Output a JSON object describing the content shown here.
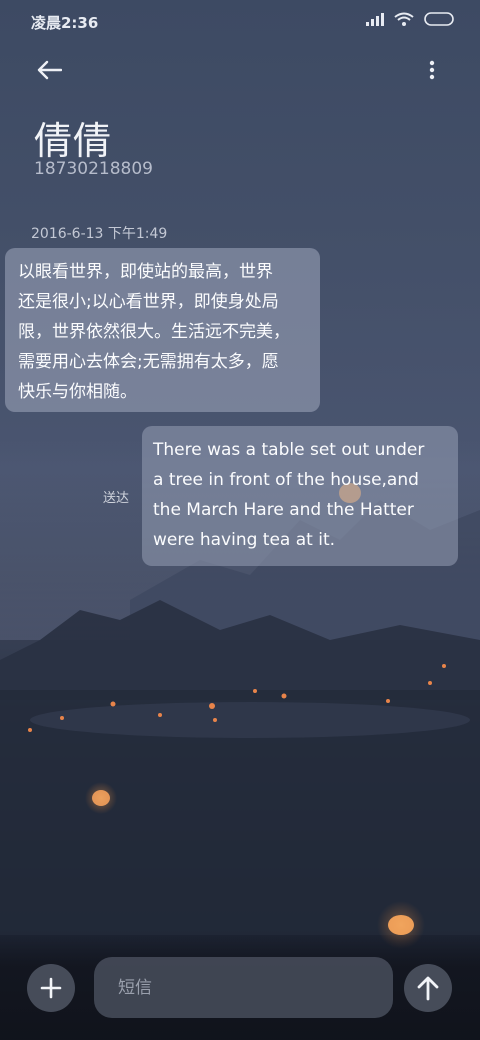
{
  "status_bar": {
    "time": "凌晨2:36",
    "icons": [
      "signal-icon",
      "wifi-icon",
      "battery-icon"
    ]
  },
  "header": {
    "back_icon": "back-arrow-icon",
    "more_icon": "more-vert-icon"
  },
  "contact": {
    "name": "倩倩",
    "number": "18730218809"
  },
  "conversation": {
    "date": "2016-6-13 下午1:49",
    "messages": [
      {
        "direction": "incoming",
        "lines": [
          "以眼看世界，即使站的最高，世界",
          "还是很小;以心看世界，即使身处局",
          "限，世界依然很大。生活远不完美，",
          "需要用心去体会;无需拥有太多，愿",
          "快乐与你相随。"
        ]
      },
      {
        "direction": "outgoing",
        "status": "送达",
        "lines": [
          "There was a table set out under",
          "a tree in front of the house,and",
          "the March Hare and the Hatter",
          "were having tea at it."
        ]
      }
    ]
  },
  "composer": {
    "placeholder": "短信",
    "value": "",
    "add_icon": "plus-icon",
    "send_icon": "send-arrow-icon"
  },
  "colors": {
    "bubble": "#a0a8be",
    "background_top": "#3d4a63",
    "background_bottom": "#161b27"
  }
}
